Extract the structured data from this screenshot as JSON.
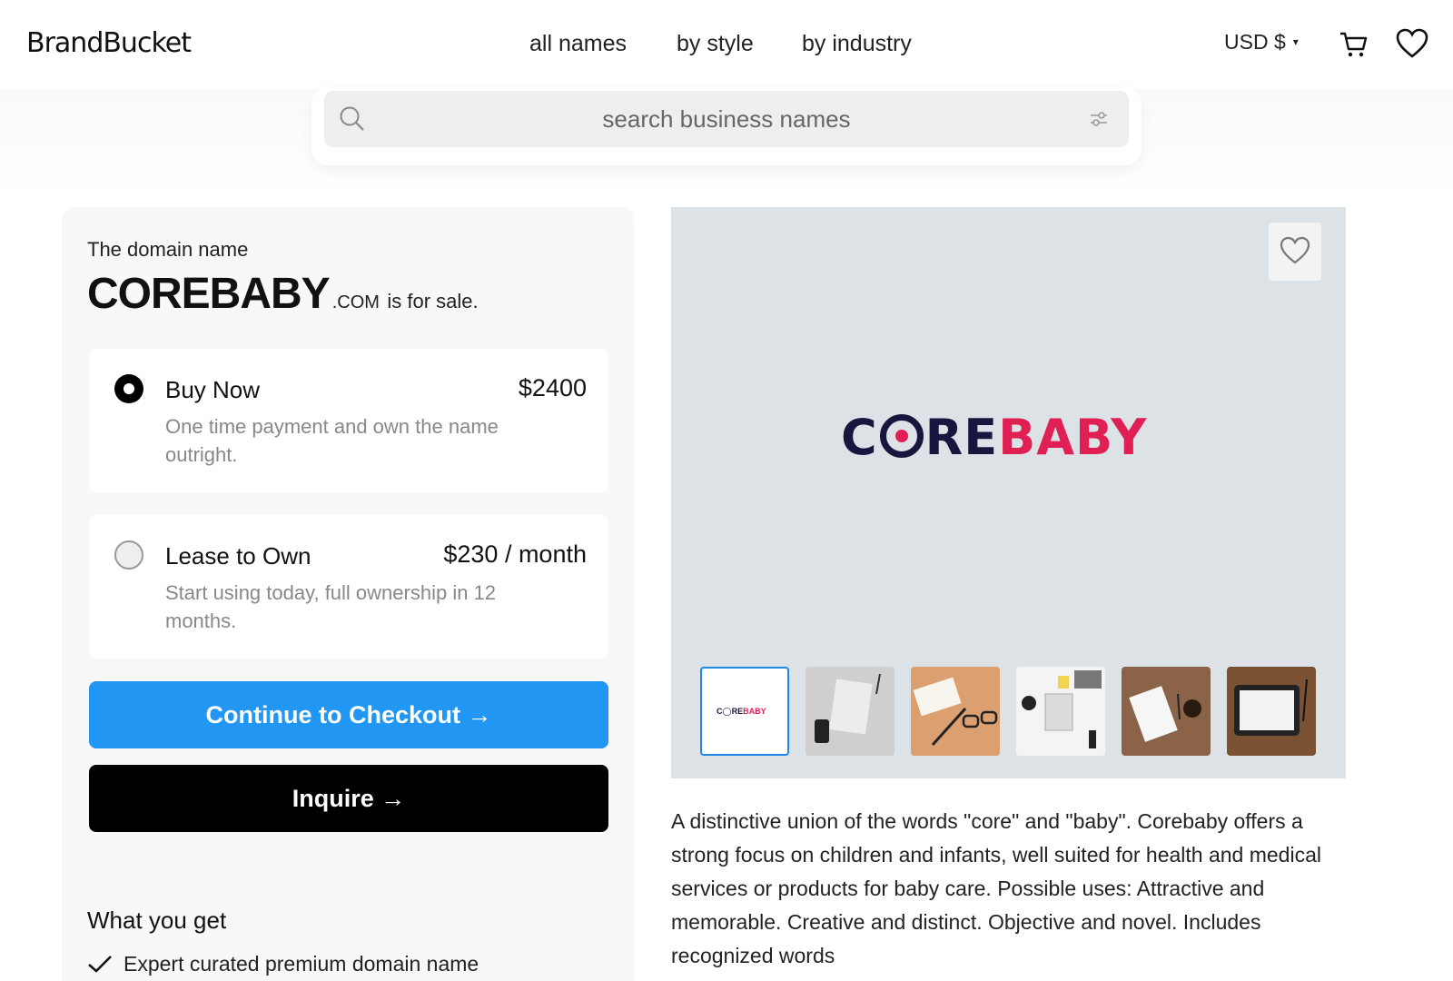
{
  "header": {
    "logo": "BrandBucket",
    "nav": [
      "all names",
      "by style",
      "by industry"
    ],
    "currency": "USD $",
    "currency_caret": "▾"
  },
  "search": {
    "placeholder": "search business names"
  },
  "listing": {
    "intro": "The domain name",
    "name": "COREBABY",
    "tld": ".COM",
    "for_sale": "is for sale.",
    "options": [
      {
        "title": "Buy Now",
        "price": "$2400",
        "description": "One time payment and own the name outright.",
        "selected": true
      },
      {
        "title": "Lease to Own",
        "price": "$230 / month",
        "description": "Start using today, full ownership in 12 months.",
        "selected": false
      }
    ],
    "checkout_label": "Continue to Checkout →",
    "inquire_label": "Inquire →",
    "what_you_get_title": "What you get",
    "benefits": [
      "Expert curated premium domain name"
    ]
  },
  "preview": {
    "logo_dark": "C",
    "logo_dark_rest": "RE",
    "logo_accent": "BABY",
    "mini_logo_dark": "C◯RE",
    "mini_logo_accent": "BABY",
    "colors": {
      "logo_dark": "#16163f",
      "logo_accent": "#e01f55",
      "preview_bg": "#dde2e7"
    }
  },
  "description": "A distinctive union of the words \"core\" and \"baby\". Corebaby offers a strong focus on children and infants, well suited for health and medical services or products for baby care. Possible uses: Attractive and memorable. Creative and distinct. Objective and novel. Includes recognized words",
  "colors": {
    "checkout_button": "#2196f3",
    "inquire_button": "#000000",
    "panel_bg": "#f8f8f8"
  }
}
